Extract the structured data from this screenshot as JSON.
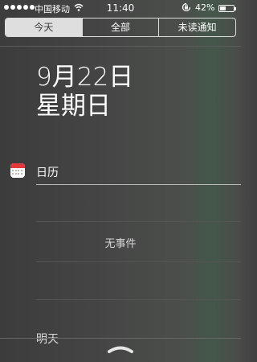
{
  "status_bar": {
    "carrier": "中国移动",
    "time": "11:40",
    "battery_percent": "42%",
    "battery_level": 0.42,
    "signal_dots": 5
  },
  "tabs": [
    {
      "label": "今天",
      "active": true
    },
    {
      "label": "全部",
      "active": false
    },
    {
      "label": "未读通知",
      "active": false
    }
  ],
  "today": {
    "date": "9月22日",
    "weekday": "星期日"
  },
  "calendar": {
    "title": "日历",
    "empty_text": "无事件",
    "accent_color": "#e0393e"
  },
  "tomorrow": {
    "title": "明天"
  },
  "icons": {
    "wifi": "wifi-icon",
    "lock": "orientation-lock-icon",
    "battery": "battery-icon",
    "calendar": "calendar-icon",
    "grabber": "pull-up-handle-icon"
  }
}
